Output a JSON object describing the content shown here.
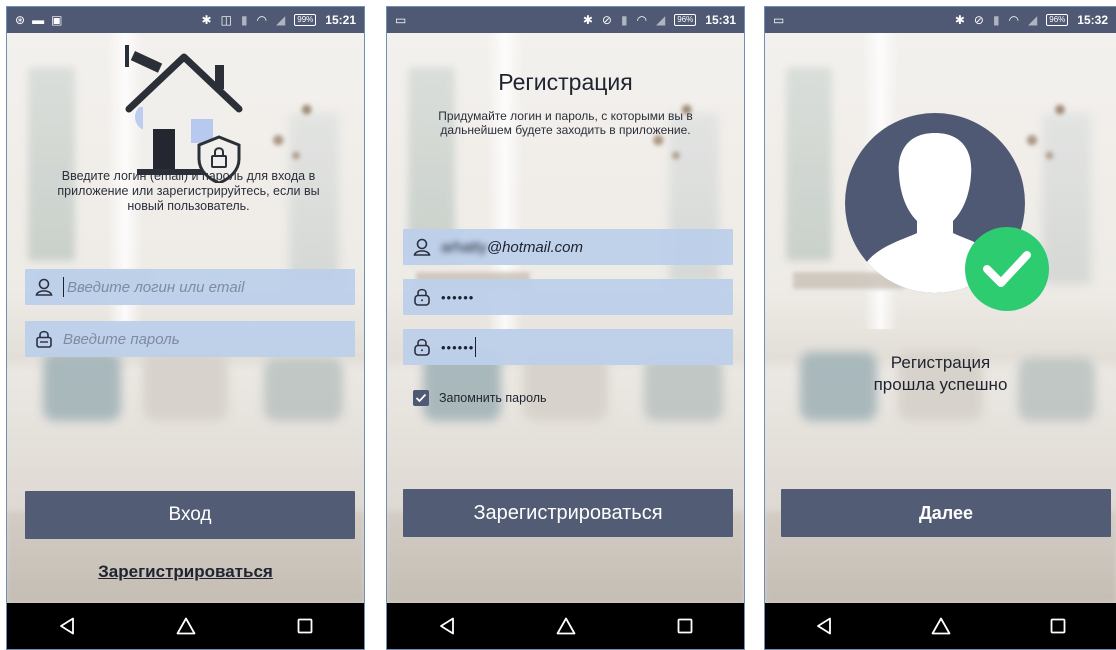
{
  "login": {
    "status_time": "15:21",
    "battery": "99%",
    "description": "Введите логин (email) и пароль для входа в приложение или зарегистрируйтесь, если вы новый пользователь.",
    "login_placeholder": "Введите логин или email",
    "password_placeholder": "Введите пароль",
    "login_button": "Вход",
    "register_link": "Зарегистрироваться",
    "icons": [
      "house-icon",
      "camera-icon",
      "shield-lock-icon",
      "user-icon",
      "lock-icon"
    ]
  },
  "register": {
    "status_time": "15:31",
    "battery": "96%",
    "title": "Регистрация",
    "description": "Придумайте логин и пароль, с которыми вы в дальнейшем будете заходить в приложение.",
    "email_value": "@hotmail.com",
    "email_value_hidden": "arhatty",
    "password_value": "••••••",
    "password_confirm_value": "••••••",
    "remember_label": "Запомнить пароль",
    "remember_checked": true,
    "register_button": "Зарегистрироваться"
  },
  "success": {
    "status_time": "15:32",
    "battery": "96%",
    "message_line1": "Регистрация",
    "message_line2": "прошла успешно",
    "next_button": "Далее",
    "icons": [
      "avatar-icon",
      "check-icon"
    ]
  },
  "colors": {
    "status_bar": "#4f5973",
    "button": "#535c75",
    "input": "#bdd0ea",
    "success_green": "#2ecc71",
    "avatar": "#4f5973"
  }
}
